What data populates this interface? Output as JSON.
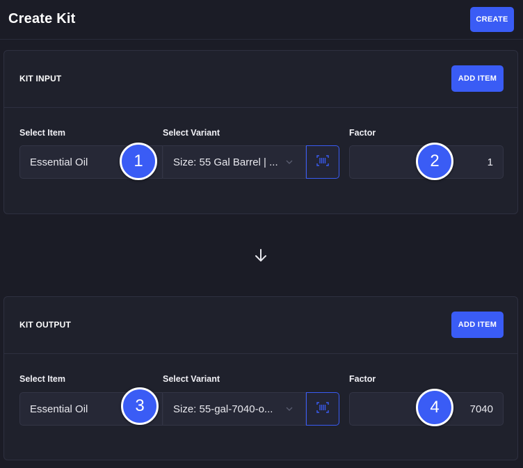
{
  "header": {
    "title": "Create Kit",
    "create_label": "CREATE"
  },
  "kit_input": {
    "title": "KIT INPUT",
    "add_item_label": "ADD ITEM",
    "labels": {
      "item": "Select Item",
      "variant": "Select Variant",
      "factor": "Factor"
    },
    "item_value": "Essential Oil",
    "variant_value": "Size: 55 Gal Barrel | ...",
    "factor_value": "1",
    "badges": [
      "1",
      "2"
    ]
  },
  "kit_output": {
    "title": "KIT OUTPUT",
    "add_item_label": "ADD ITEM",
    "labels": {
      "item": "Select Item",
      "variant": "Select Variant",
      "factor": "Factor"
    },
    "item_value": "Essential Oil",
    "variant_value": "Size: 55-gal-7040-o...",
    "factor_value": "7040",
    "badges": [
      "3",
      "4"
    ]
  },
  "icons": {
    "flow_arrow": "arrow-down-icon",
    "dropdown": "chevron-down-icon",
    "scan": "barcode-scan-icon"
  },
  "colors": {
    "accent": "#3a5cf5",
    "background": "#1b1c26",
    "panel": "#1f212c"
  }
}
